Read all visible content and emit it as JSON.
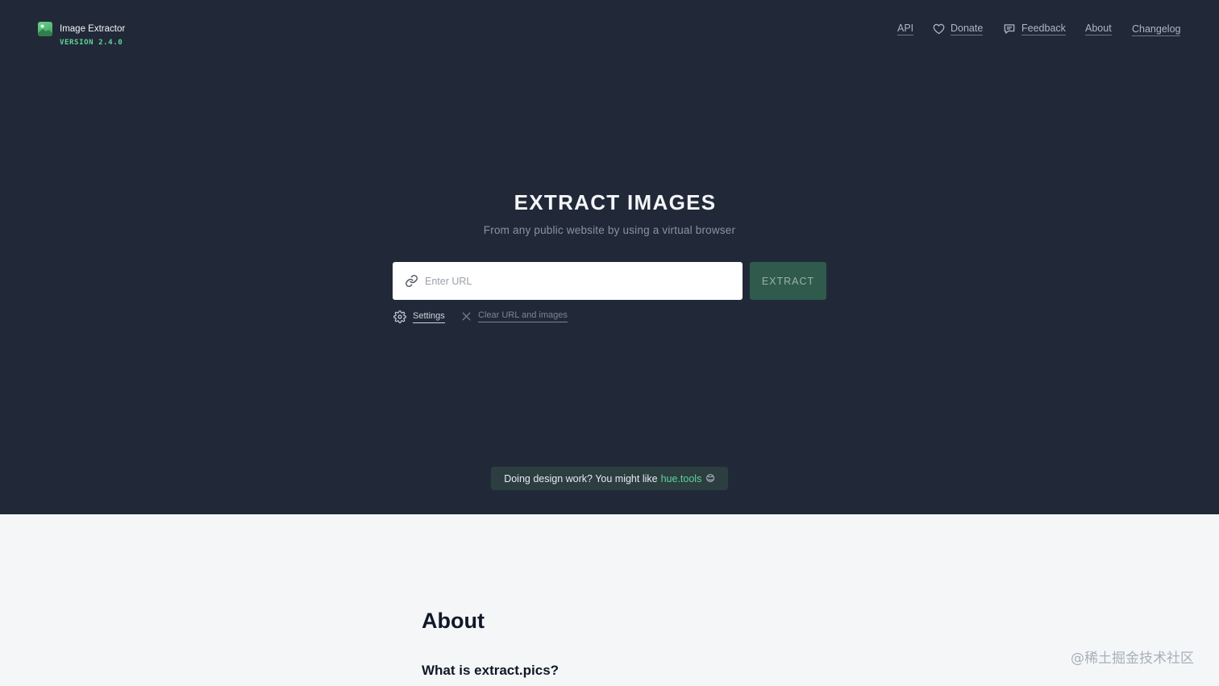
{
  "brand": {
    "name": "Image Extractor",
    "version": "VERSION 2.4.0",
    "accent_color": "#5fd49a"
  },
  "nav": {
    "items": [
      {
        "label": "API",
        "icon": null
      },
      {
        "label": "Donate",
        "icon": "heart-icon"
      },
      {
        "label": "Feedback",
        "icon": "chat-icon"
      },
      {
        "label": "About",
        "icon": null
      },
      {
        "label": "Changelog",
        "icon": null
      }
    ]
  },
  "hero": {
    "title": "EXTRACT IMAGES",
    "subtitle": "From any public website by using a virtual browser",
    "url_placeholder": "Enter URL",
    "url_value": "",
    "extract_label": "EXTRACT",
    "settings_label": "Settings",
    "clear_label": "Clear URL and images"
  },
  "promo": {
    "text": "Doing design work? You might like",
    "link": "hue.tools",
    "emoji": "😊"
  },
  "about": {
    "title": "About",
    "question": "What is extract.pics?"
  },
  "watermark": "@稀土掘金技术社区",
  "colors": {
    "hero_bg": "#212938",
    "page_bg": "#f4f6f8",
    "button_bg": "#2f5a4c",
    "promo_bg": "#2c3e40"
  }
}
